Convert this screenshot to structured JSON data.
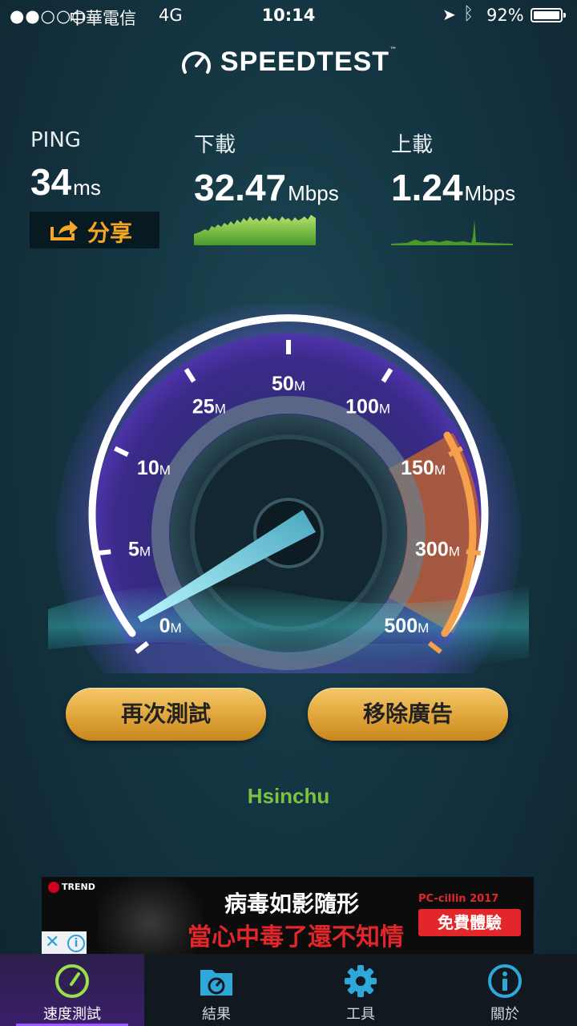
{
  "status_bar": {
    "signal": "●●○○○",
    "carrier": "中華電信",
    "network": "4G",
    "time": "10:14",
    "battery": "92%"
  },
  "app": {
    "logo": "SPEEDTEST",
    "logo_mark": "™"
  },
  "results": {
    "ping": {
      "label": "PING",
      "value": "34",
      "unit": "ms"
    },
    "download": {
      "label": "下載",
      "value": "32.47",
      "unit": "Mbps"
    },
    "upload": {
      "label": "上載",
      "value": "1.24",
      "unit": "Mbps"
    }
  },
  "share_label": "分享",
  "gauge": {
    "unit": "M",
    "ticks": [
      "0",
      "5",
      "10",
      "25",
      "50",
      "100",
      "150",
      "300",
      "500"
    ],
    "needle_value_mbps": 1.24
  },
  "buttons": {
    "retest": "再次測試",
    "remove_ads": "移除廣告"
  },
  "server": "Hsinchu",
  "ad": {
    "brand": "TREND",
    "headline": "病毒如影隨形",
    "subheadline": "當心中毒了還不知情",
    "product": "PC-cillin 2017",
    "cta": "免費體驗"
  },
  "tabs": [
    {
      "label": "速度測試",
      "icon": "speedometer-icon",
      "active": true
    },
    {
      "label": "結果",
      "icon": "results-folder-icon",
      "active": false
    },
    {
      "label": "工具",
      "icon": "gear-icon",
      "active": false
    },
    {
      "label": "關於",
      "icon": "info-icon",
      "active": false
    }
  ],
  "colors": {
    "accent_green": "#7dc242",
    "button_gold": "#e0a53a",
    "gauge_orange": "#f08a24",
    "tab_active": "#9b59ff"
  }
}
